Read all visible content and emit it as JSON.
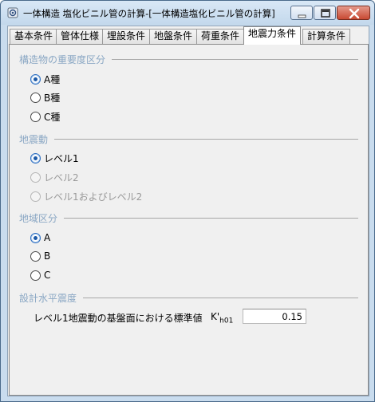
{
  "window": {
    "title": "一体構造 塩化ビニル管の計算-[一体構造塩化ビニル管の計算]"
  },
  "tabs": [
    {
      "label": "基本条件"
    },
    {
      "label": "管体仕様"
    },
    {
      "label": "埋設条件"
    },
    {
      "label": "地盤条件"
    },
    {
      "label": "荷重条件"
    },
    {
      "label": "地震力条件",
      "active": true
    },
    {
      "label": "計算条件"
    }
  ],
  "groups": {
    "importance": {
      "title": "構造物の重要度区分",
      "options": [
        {
          "label": "A種",
          "checked": true
        },
        {
          "label": "B種",
          "checked": false
        },
        {
          "label": "C種",
          "checked": false
        }
      ]
    },
    "motion": {
      "title": "地震動",
      "options": [
        {
          "label": "レベル1",
          "checked": true
        },
        {
          "label": "レベル2",
          "checked": false,
          "disabled": true
        },
        {
          "label": "レベル1およびレベル2",
          "checked": false,
          "disabled": true
        }
      ]
    },
    "region": {
      "title": "地域区分",
      "options": [
        {
          "label": "A",
          "checked": true
        },
        {
          "label": "B",
          "checked": false
        },
        {
          "label": "C",
          "checked": false
        }
      ]
    },
    "horizontal": {
      "title": "設計水平震度",
      "field_label": "レベル1地震動の基盤面における標準値",
      "symbol": "K'",
      "symbol_sub": "h01",
      "value": "0.15"
    }
  },
  "colors": {
    "group_title": "#8aa7c4",
    "radio_accent": "#1d5aa8",
    "close_button": "#c84a33"
  }
}
